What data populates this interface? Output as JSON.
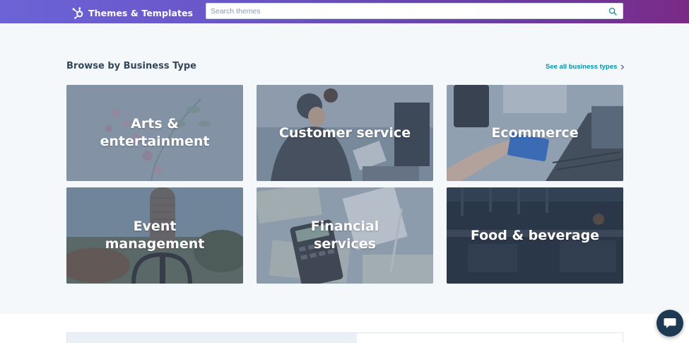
{
  "header": {
    "brand_title": "Themes & Templates",
    "search_placeholder": "Search themes"
  },
  "section": {
    "title": "Browse by Business Type",
    "see_all_label": "See all business types"
  },
  "tiles": [
    {
      "label": "Arts & entertainment"
    },
    {
      "label": "Customer service"
    },
    {
      "label": "Ecommerce"
    },
    {
      "label": "Event management"
    },
    {
      "label": "Financial services"
    },
    {
      "label": "Food & beverage"
    }
  ],
  "colors": {
    "header_gradient_start": "#6b63d6",
    "header_gradient_end": "#7a2a86",
    "link": "#0091ae",
    "heading": "#33475b",
    "page_bg": "#f5f8fa",
    "chat_button": "#1e3a52"
  },
  "icons": [
    "hubspot-logo-icon",
    "search-icon",
    "chevron-right-icon",
    "chat-icon"
  ]
}
